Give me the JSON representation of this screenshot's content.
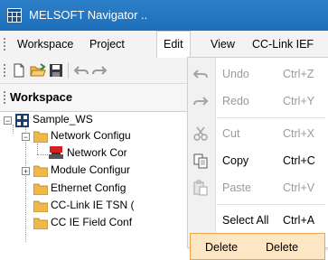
{
  "window": {
    "title": "MELSOFT Navigator ..",
    "icon": "app-grid-icon"
  },
  "menubar": {
    "items": [
      {
        "label": "Workspace"
      },
      {
        "label": "Project"
      },
      {
        "label": "Edit"
      },
      {
        "label": "View"
      },
      {
        "label": "CC-Link IEF"
      }
    ]
  },
  "toolbar": {
    "buttons": [
      "new-file-icon",
      "open-folder-icon",
      "save-icon",
      "undo-icon",
      "redo-icon"
    ]
  },
  "panel": {
    "title": "Workspace"
  },
  "tree": [
    {
      "label": "Sample_WS",
      "icon": "workspace-icon"
    },
    {
      "label": "Network Configu",
      "icon": "folder-icon"
    },
    {
      "label": "Network Cor",
      "icon": "network-icon"
    },
    {
      "label": "Module Configur",
      "icon": "folder-icon"
    },
    {
      "label": "Ethernet Config",
      "icon": "folder-icon"
    },
    {
      "label": "CC-Link IE TSN (",
      "icon": "folder-icon"
    },
    {
      "label": "CC IE Field Conf",
      "icon": "folder-icon"
    }
  ],
  "edit_menu": {
    "items": [
      {
        "label": "Undo",
        "shortcut": "Ctrl+Z",
        "icon": "undo-icon",
        "enabled": false
      },
      {
        "label": "Redo",
        "shortcut": "Ctrl+Y",
        "icon": "redo-icon",
        "enabled": false
      },
      {
        "label": "Cut",
        "shortcut": "Ctrl+X",
        "icon": "scissors-icon",
        "enabled": false
      },
      {
        "label": "Copy",
        "shortcut": "Ctrl+C",
        "icon": "copy-icon",
        "enabled": true
      },
      {
        "label": "Paste",
        "shortcut": "Ctrl+V",
        "icon": "paste-icon",
        "enabled": false
      },
      {
        "label": "Select All",
        "shortcut": "Ctrl+A",
        "icon": "",
        "enabled": true
      },
      {
        "label": "Delete",
        "shortcut": "Delete",
        "icon": "",
        "enabled": true,
        "highlighted": true
      }
    ]
  },
  "colors": {
    "titlebar": "#2d7fc9",
    "highlight": "#fde6c4",
    "highlight_border": "#e9a54f",
    "folder": "#f0b74a"
  }
}
